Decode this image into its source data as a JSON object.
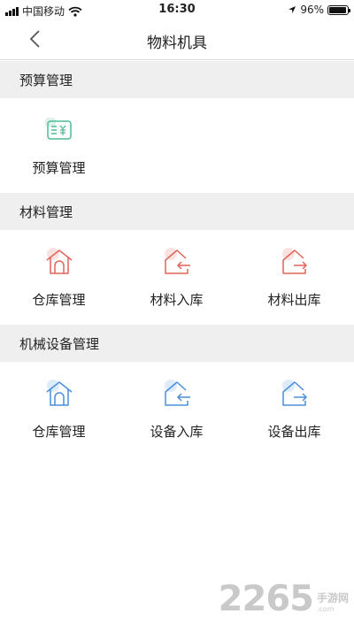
{
  "status_bar": {
    "carrier": "中国移动",
    "time": "16:30",
    "battery": "96%",
    "battery_level": 0.96,
    "wifi_icon": "wifi-icon",
    "location_icon": "location-arrow-icon"
  },
  "nav": {
    "title": "物料机具",
    "back_icon": "chevron-left-icon"
  },
  "sections": [
    {
      "title": "预算管理",
      "items": [
        {
          "label": "预算管理",
          "icon": "budget-icon",
          "color": "#4dbb94"
        }
      ]
    },
    {
      "title": "材料管理",
      "items": [
        {
          "label": "仓库管理",
          "icon": "warehouse-icon",
          "color": "#e06459"
        },
        {
          "label": "材料入库",
          "icon": "stock-in-icon",
          "color": "#e06459"
        },
        {
          "label": "材料出库",
          "icon": "stock-out-icon",
          "color": "#e06459"
        }
      ]
    },
    {
      "title": "机械设备管理",
      "items": [
        {
          "label": "仓库管理",
          "icon": "warehouse-icon",
          "color": "#4a8fdb"
        },
        {
          "label": "设备入库",
          "icon": "stock-in-icon",
          "color": "#4a8fdb"
        },
        {
          "label": "设备出库",
          "icon": "stock-out-icon",
          "color": "#4a8fdb"
        }
      ]
    }
  ],
  "watermark": {
    "number": "2265",
    "name": "手游网",
    "domain": ".com"
  }
}
